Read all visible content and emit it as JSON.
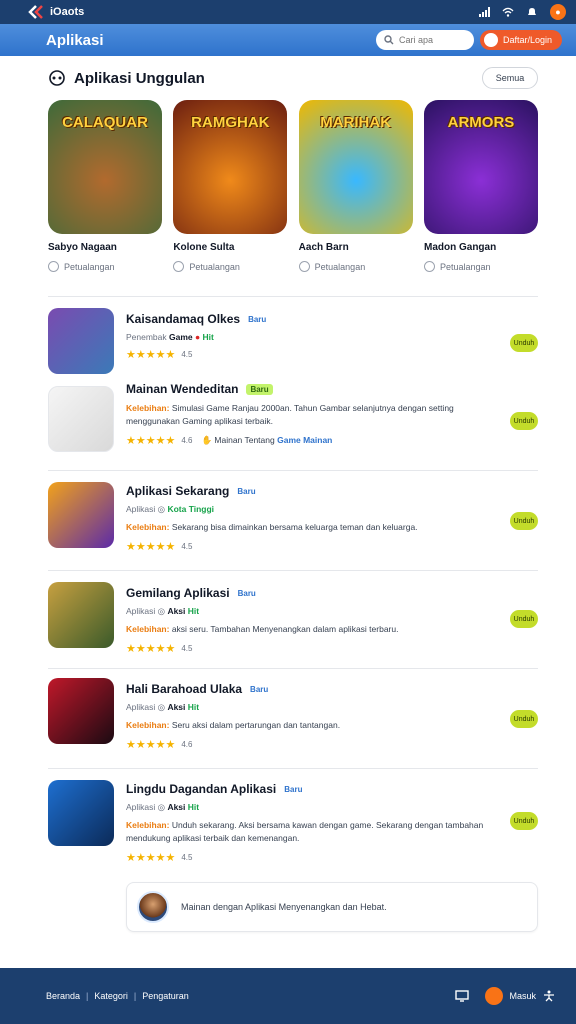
{
  "status_bar": {
    "title": "iOaots"
  },
  "header": {
    "title": "Aplikasi",
    "search_placeholder": "Cari apa",
    "login_label": "Daftar/Login"
  },
  "section": {
    "title": "Aplikasi Unggulan",
    "see_all_label": "Semua"
  },
  "featured": [
    {
      "name": "Sabyo Nagaan",
      "category": "Petualangan",
      "art_title": "CALAQUAR",
      "colors": [
        "#b26a2e",
        "#3d6a3a"
      ]
    },
    {
      "name": "Kolone Sulta",
      "category": "Petualangan",
      "art_title": "RAMGHAK",
      "colors": [
        "#f08a1a",
        "#6b1e10"
      ]
    },
    {
      "name": "Aach Barn",
      "category": "Petualangan",
      "art_title": "MARIHAK",
      "colors": [
        "#39b8ff",
        "#f0b800"
      ]
    },
    {
      "name": "Madon Gangan",
      "category": "Petualangan",
      "art_title": "ARMORS",
      "colors": [
        "#8b2fd6",
        "#2a1260"
      ]
    }
  ],
  "apps": [
    {
      "name": "Kaisandamaq Olkes",
      "tag": "Baru",
      "meta": [
        "Penembak",
        "Game",
        "Hit"
      ],
      "rating": "4.5",
      "stars": 5,
      "install_label": "Unduh",
      "icon_colors": [
        "#7a4bb0",
        "#3b7ab8"
      ]
    },
    {
      "name": "Mainan Wendeditan",
      "tag": "Baru",
      "description_label": "Kelebihan:",
      "description": "Simulasi Game Ranjau 2000an. Tahun Gambar selanjutnya dengan setting menggunakan Gaming aplikasi terbaik.",
      "rating": "4.6",
      "stars": 5,
      "extra_prefix": "Mainan Tentang",
      "extra_link": "Game Mainan",
      "install_label": "Unduh",
      "icon_colors": [
        "#f5f5f5",
        "#d9d9d9"
      ]
    },
    {
      "name": "Aplikasi Sekarang",
      "tag": "Baru",
      "meta": [
        "Aplikasi",
        "Kota Tinggi"
      ],
      "description_label": "Kelebihan:",
      "description": "Sekarang bisa dimainkan bersama keluarga teman dan keluarga.",
      "rating": "4.5",
      "stars": 5,
      "install_label": "Unduh",
      "icon_colors": [
        "#f2a21b",
        "#5b2aa8"
      ]
    },
    {
      "name": "Gemilang Aplikasi",
      "tag": "Baru",
      "meta": [
        "Aplikasi",
        "Aksi",
        "Hit"
      ],
      "description_label": "Kelebihan:",
      "description": "aksi seru. Tambahan Menyenangkan dalam aplikasi terbaru.",
      "rating": "4.5",
      "stars": 5,
      "install_label": "Unduh",
      "icon_colors": [
        "#c7a040",
        "#3a5a2a"
      ]
    },
    {
      "name": "Hali Barahoad Ulaka",
      "tag": "Baru",
      "meta": [
        "Aplikasi",
        "Aksi",
        "Hit"
      ],
      "description_label": "Kelebihan:",
      "description": "Seru aksi dalam pertarungan dan tantangan.",
      "rating": "4.6",
      "stars": 5,
      "install_label": "Unduh",
      "icon_colors": [
        "#c0182a",
        "#1a0a12"
      ]
    },
    {
      "name": "Lingdu Dagandan Aplikasi",
      "tag": "Baru",
      "meta": [
        "Aplikasi",
        "Aksi",
        "Hit"
      ],
      "description_label": "Kelebihan:",
      "description": "Unduh sekarang. Aksi bersama kawan dengan game. Sekarang dengan tambahan mendukung aplikasi terbaik dan kemenangan.",
      "rating": "4.5",
      "stars": 5,
      "install_label": "Unduh",
      "icon_colors": [
        "#1e6fd0",
        "#0b2a58"
      ]
    }
  ],
  "comment": {
    "text": "Mainan dengan Aplikasi Menyenangkan dan Hebat."
  },
  "footer": {
    "links": [
      "Beranda",
      "Kategori",
      "Pengaturan"
    ],
    "right_label": "Masuk"
  },
  "colors": {
    "status_bar": "#1c3f6e",
    "app_bar": "#2f73cc",
    "accent_orange": "#ef5a2a",
    "install_button": "#c3dc2a",
    "star": "#f5b301"
  }
}
